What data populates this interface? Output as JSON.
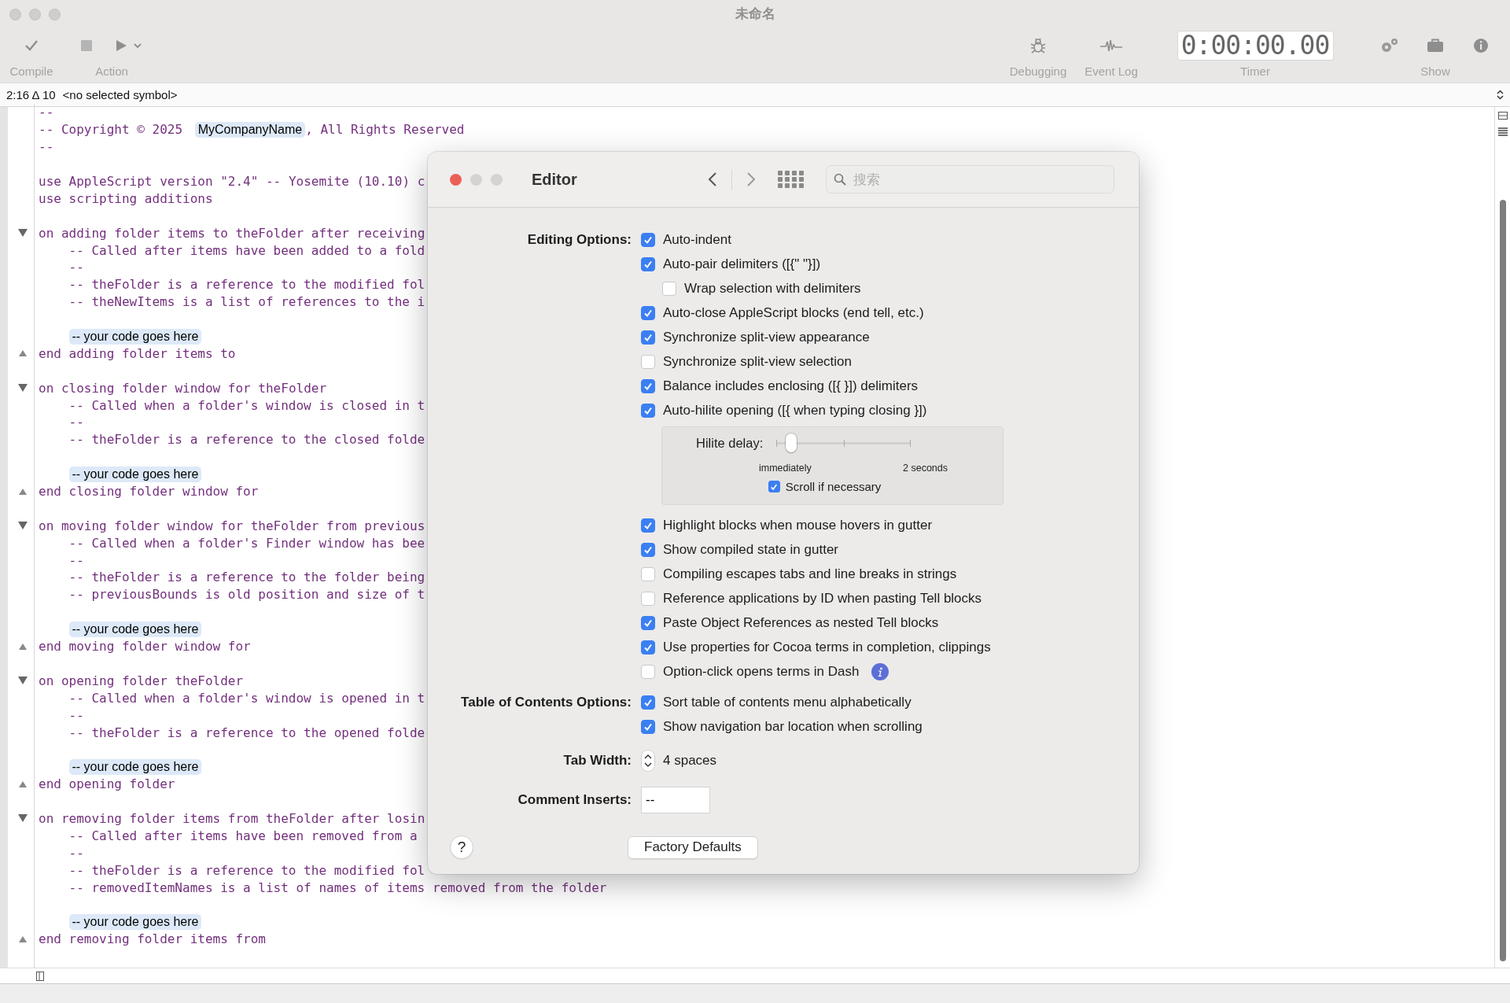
{
  "window": {
    "title": "未命名"
  },
  "toolbar": {
    "left": [
      {
        "kind": "compile",
        "label": "Compile"
      },
      {
        "kind": "action",
        "label": "Action"
      }
    ],
    "right": [
      {
        "kind": "bug",
        "label": "Debugging"
      },
      {
        "kind": "wave",
        "label": "Event Log"
      },
      {
        "kind": "timer",
        "label": "Timer",
        "display": "0:00:00.00"
      },
      {
        "kind": "gear"
      },
      {
        "kind": "briefcase",
        "label": "Show"
      },
      {
        "kind": "info"
      }
    ]
  },
  "navigation_bar": {
    "position": "2:16 Δ 10",
    "symbol": "<no selected symbol>"
  },
  "editor": {
    "lines": [
      {
        "kind": "code",
        "text": "--"
      },
      {
        "kind": "mixed",
        "parts": [
          {
            "kind": "text",
            "text": "-- Copyright © 2025 "
          },
          {
            "kind": "placeholder",
            "text": "MyCompanyName"
          },
          {
            "kind": "text",
            "text": ", All Rights Reserved"
          }
        ]
      },
      {
        "kind": "code",
        "text": "--"
      },
      {
        "kind": "blank"
      },
      {
        "kind": "code",
        "text": "use AppleScript version \"2.4\" -- Yosemite (10.10) c"
      },
      {
        "kind": "code",
        "text": "use scripting additions"
      },
      {
        "kind": "blank"
      },
      {
        "kind": "handler-start",
        "text": "on adding folder items to theFolder after receiving"
      },
      {
        "kind": "indented",
        "text": "-- Called after items have been added to a fold"
      },
      {
        "kind": "indented",
        "text": "--"
      },
      {
        "kind": "indented",
        "text": "-- theFolder is a reference to the modified fol"
      },
      {
        "kind": "indented",
        "text": "-- theNewItems is a list of references to the i"
      },
      {
        "kind": "blank"
      },
      {
        "kind": "placeholder",
        "text": "-- your code goes here"
      },
      {
        "kind": "handler-end",
        "text": "end adding folder items to"
      },
      {
        "kind": "blank"
      },
      {
        "kind": "handler-start",
        "text": "on closing folder window for theFolder"
      },
      {
        "kind": "indented",
        "text": "-- Called when a folder's window is closed in t"
      },
      {
        "kind": "indented",
        "text": "--"
      },
      {
        "kind": "indented",
        "text": "-- theFolder is a reference to the closed folde"
      },
      {
        "kind": "blank"
      },
      {
        "kind": "placeholder",
        "text": "-- your code goes here"
      },
      {
        "kind": "handler-end",
        "text": "end closing folder window for"
      },
      {
        "kind": "blank"
      },
      {
        "kind": "handler-start",
        "text": "on moving folder window for theFolder from previous"
      },
      {
        "kind": "indented",
        "text": "-- Called when a folder's Finder window has bee"
      },
      {
        "kind": "indented",
        "text": "--"
      },
      {
        "kind": "indented",
        "text": "-- theFolder is a reference to the folder being"
      },
      {
        "kind": "indented",
        "text": "-- previousBounds is old position and size of t"
      },
      {
        "kind": "blank"
      },
      {
        "kind": "placeholder",
        "text": "-- your code goes here"
      },
      {
        "kind": "handler-end",
        "text": "end moving folder window for"
      },
      {
        "kind": "blank"
      },
      {
        "kind": "handler-start",
        "text": "on opening folder theFolder"
      },
      {
        "kind": "indented",
        "text": "-- Called when a folder's window is opened in t"
      },
      {
        "kind": "indented",
        "text": "--"
      },
      {
        "kind": "indented",
        "text": "-- theFolder is a reference to the opened folde"
      },
      {
        "kind": "blank"
      },
      {
        "kind": "placeholder",
        "text": "-- your code goes here"
      },
      {
        "kind": "handler-end",
        "text": "end opening folder"
      },
      {
        "kind": "blank"
      },
      {
        "kind": "handler-start",
        "text": "on removing folder items from theFolder after losin"
      },
      {
        "kind": "indented",
        "text": "-- Called after items have been removed from a"
      },
      {
        "kind": "indented",
        "text": "--"
      },
      {
        "kind": "indented",
        "text": "-- theFolder is a reference to the modified fol"
      },
      {
        "kind": "indented",
        "text": "-- removedItemNames is a list of names of items removed from the folder"
      },
      {
        "kind": "blank"
      },
      {
        "kind": "placeholder",
        "text": "-- your code goes here"
      },
      {
        "kind": "handler-end",
        "text": "end removing folder items from"
      }
    ]
  },
  "dialog": {
    "title": "Editor",
    "search_placeholder": "搜索",
    "sections": [
      {
        "label": "Editing Options:",
        "options": [
          {
            "kind": "checkbox",
            "label": "Auto-indent",
            "checked": true
          },
          {
            "kind": "checkbox",
            "label": "Auto-pair delimiters ([{\" \"}])",
            "checked": true
          },
          {
            "kind": "nested-checkbox",
            "label": "Wrap selection with delimiters",
            "checked": false
          },
          {
            "kind": "checkbox",
            "label": "Auto-close AppleScript blocks (end tell, etc.)",
            "checked": true
          },
          {
            "kind": "checkbox",
            "label": "Synchronize split-view appearance",
            "checked": true
          },
          {
            "kind": "checkbox",
            "label": "Synchronize split-view selection",
            "checked": false
          },
          {
            "kind": "checkbox",
            "label": "Balance includes enclosing ([{ }]) delimiters",
            "checked": true
          },
          {
            "kind": "checkbox",
            "label": "Auto-hilite opening ([{ when typing closing }])",
            "checked": true
          },
          {
            "kind": "slider-panel",
            "label": "Hilite delay:",
            "level": 0.11,
            "min_label": "immediately",
            "max_label": "2 seconds",
            "option": {
              "label": "Scroll if necessary",
              "checked": true
            }
          },
          {
            "kind": "checkbox",
            "label": "Highlight blocks when mouse hovers in gutter",
            "checked": true
          },
          {
            "kind": "checkbox",
            "label": "Show compiled state in gutter",
            "checked": true
          },
          {
            "kind": "checkbox",
            "label": "Compiling escapes tabs and line breaks in strings",
            "checked": false
          },
          {
            "kind": "checkbox",
            "label": "Reference applications by ID when pasting Tell blocks",
            "checked": false
          },
          {
            "kind": "checkbox",
            "label": "Paste Object References as nested Tell blocks",
            "checked": true
          },
          {
            "kind": "checkbox",
            "label": "Use properties for Cocoa terms in completion, clippings",
            "checked": true
          },
          {
            "kind": "checkbox-info",
            "label": "Option-click opens terms in Dash",
            "checked": false
          }
        ]
      },
      {
        "label": "Table of Contents Options:",
        "options": [
          {
            "kind": "checkbox",
            "label": "Sort table of contents menu alphabetically",
            "checked": true
          },
          {
            "kind": "checkbox",
            "label": "Show navigation bar location when scrolling",
            "checked": true
          }
        ]
      }
    ],
    "tab_width": {
      "label": "Tab Width:",
      "value": "4 spaces"
    },
    "comment_inserts": {
      "label": "Comment Inserts:",
      "value": "--"
    },
    "help": "?",
    "factory_defaults": "Factory Defaults"
  }
}
